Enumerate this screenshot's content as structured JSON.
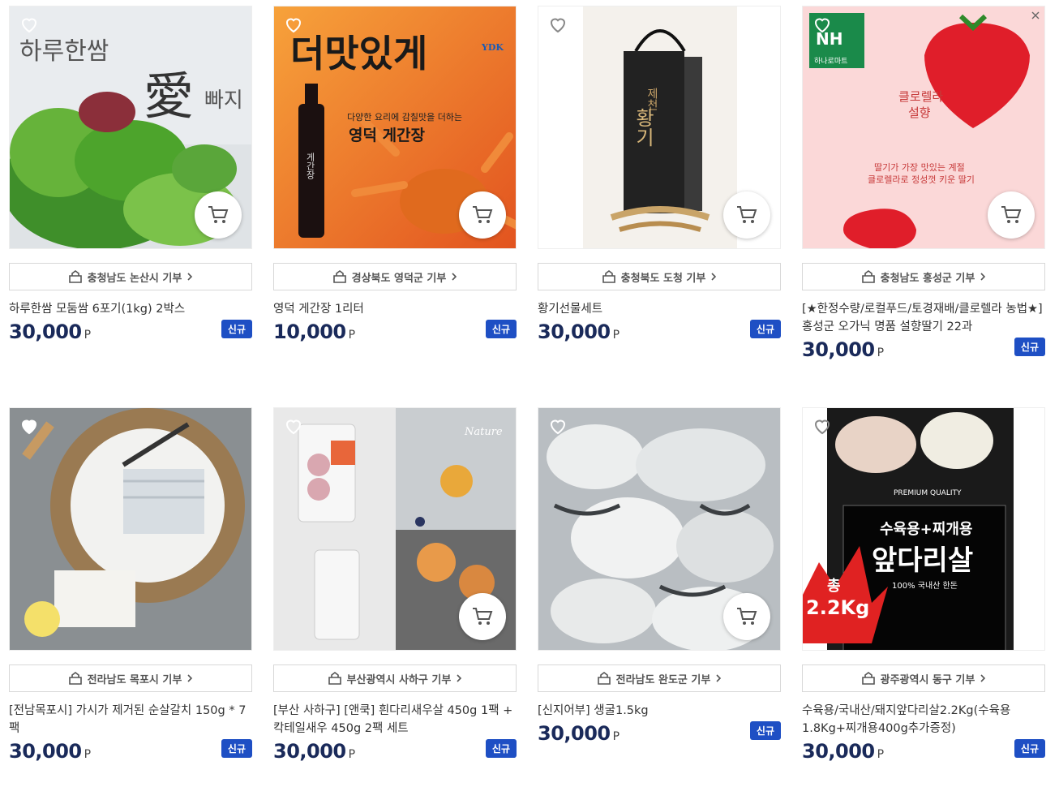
{
  "products": [
    {
      "donation": "충청남도 논산시 기부",
      "title": "하루한쌈 모둠쌈 6포기(1kg) 2박스",
      "price": "30,000",
      "unit": "P",
      "badge": "신규",
      "art_text": [
        "하루한쌈",
        "愛",
        "빠지"
      ]
    },
    {
      "donation": "경상북도 영덕군 기부",
      "title": "영덕 게간장 1리터",
      "price": "10,000",
      "unit": "P",
      "badge": "신규",
      "art_text": [
        "더맛있게",
        "다양한 요리에 감칠맛을 더하는",
        "영덕 게간장",
        "YDK",
        "게간장"
      ]
    },
    {
      "donation": "충청북도 도청 기부",
      "title": "황기선물세트",
      "price": "30,000",
      "unit": "P",
      "badge": "신규",
      "art_text": [
        "제천",
        "황기"
      ]
    },
    {
      "donation": "충청남도 홍성군 기부",
      "title": "[★한정수량/로컬푸드/토경재배/클로렐라 농법★] 홍성군 오가닉 명품 설향딸기 22과",
      "price": "30,000",
      "unit": "P",
      "badge": "신규",
      "art_text": [
        "NH",
        "하나로마트",
        "클로렐라",
        "설향",
        "딸기가 가장 맛있는 계절",
        "클로렐라로 정성껏 키운 딸기"
      ]
    },
    {
      "donation": "전라남도 목포시 기부",
      "title": "[전남목포시] 가시가 제거된 순살갈치 150g * 7팩",
      "price": "30,000",
      "unit": "P",
      "badge": "신규",
      "art_text": []
    },
    {
      "donation": "부산광역시 사하구 기부",
      "title": "[부산 사하구] [앤쿡] 흰다리새우살 450g 1팩 + 칵테일새우 450g 2팩 세트",
      "price": "30,000",
      "unit": "P",
      "badge": "신규",
      "art_text": [
        "Nature"
      ]
    },
    {
      "donation": "전라남도 완도군 기부",
      "title": "[신지어부] 생굴1.5kg",
      "price": "30,000",
      "unit": "P",
      "badge": "신규",
      "art_text": []
    },
    {
      "donation": "광주광역시 동구 기부",
      "title": "수육용/국내산/돼지앞다리살2.2Kg(수육용1.8Kg+찌개용400g추가증정)",
      "price": "30,000",
      "unit": "P",
      "badge": "신규",
      "art_text": [
        "PREMIUM QUALITY",
        "수육용+찌개용",
        "앞다리살",
        "100% 국내산 한돈",
        "총",
        "2.2Kg"
      ]
    }
  ],
  "icons": {
    "heart": "heart-icon",
    "cart": "cart-icon",
    "donate": "donation-box-icon",
    "chevron": "chevron-right-icon",
    "ad": "ad-close-icon"
  },
  "colors": {
    "price": "#1a2a5a",
    "badge": "#1e4fc4"
  }
}
